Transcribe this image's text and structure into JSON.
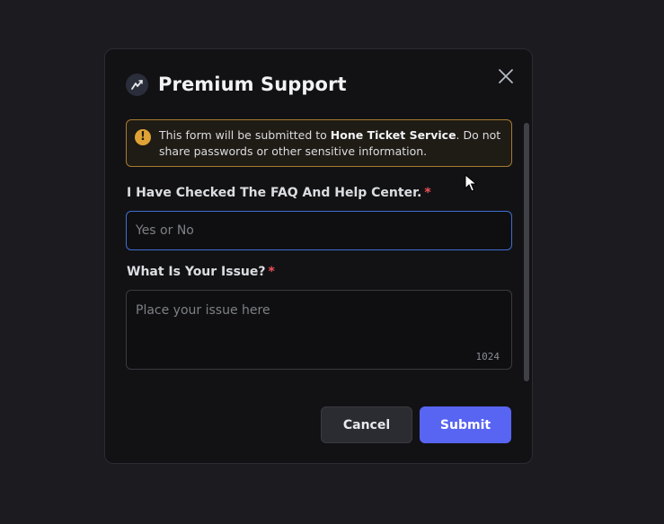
{
  "dialog": {
    "title": "Premium Support",
    "logo_icon": "hone-lightning-icon",
    "close_icon": "close-icon"
  },
  "notice": {
    "text_before": "This form will be submitted to ",
    "service_name": "Hone Ticket Service",
    "text_after": ". Do not share passwords or other sensitive information.",
    "icon": "warning-icon",
    "accent_color": "#e0a336"
  },
  "fields": {
    "faq": {
      "label": "I Have Checked The FAQ And Help Center.",
      "required_mark": "*",
      "placeholder": "Yes or No",
      "value": ""
    },
    "issue": {
      "label": "What Is Your Issue?",
      "required_mark": "*",
      "placeholder": "Place your issue here",
      "value": "",
      "char_limit": "1024"
    }
  },
  "actions": {
    "cancel_label": "Cancel",
    "submit_label": "Submit",
    "submit_color": "#5865f2"
  }
}
